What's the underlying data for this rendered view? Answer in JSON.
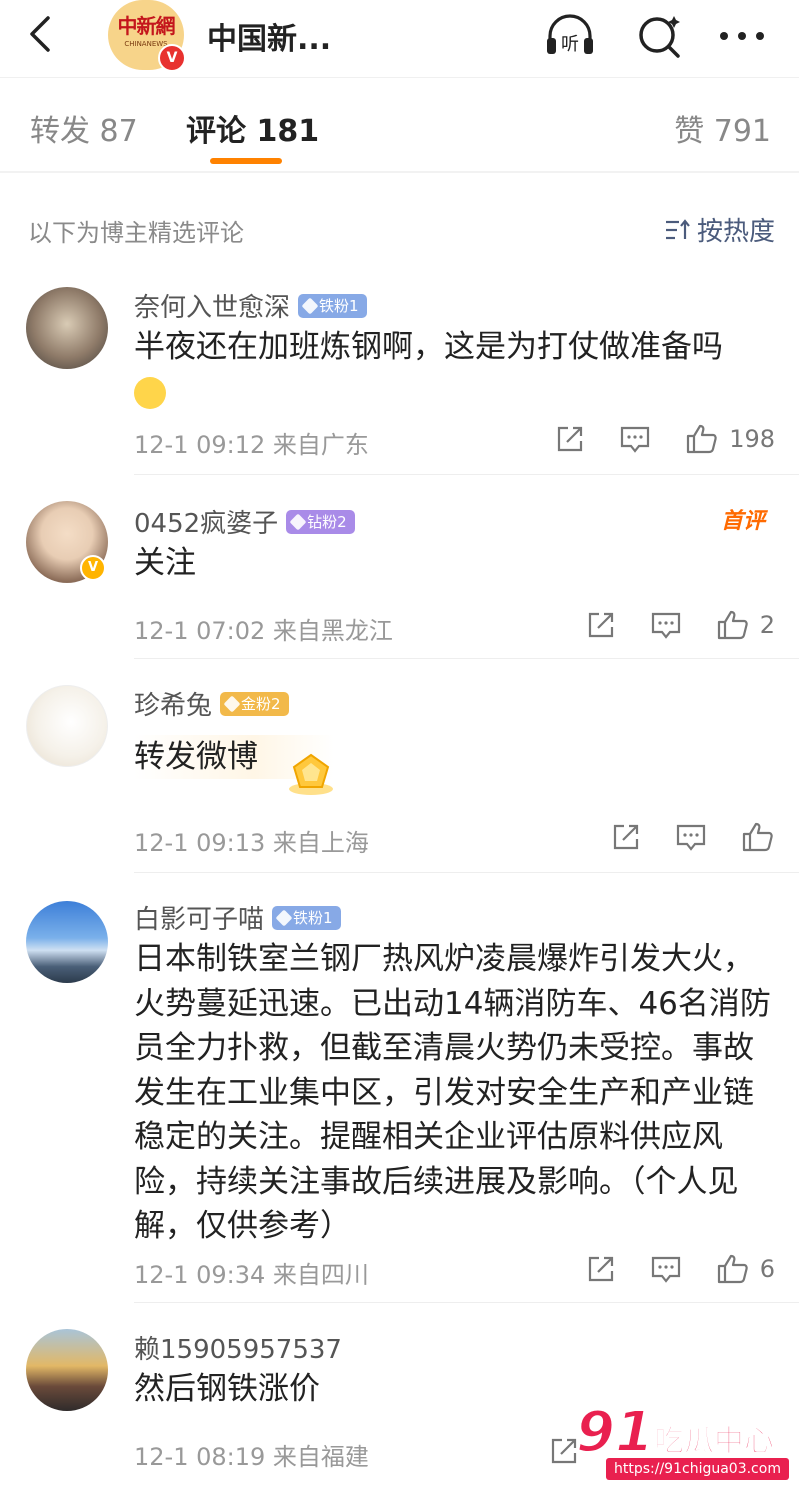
{
  "header": {
    "title": "中国新...",
    "logo_text": "中新網",
    "logo_sub": "CHINANEWS",
    "verified_mark": "V"
  },
  "tabs": [
    {
      "label": "转发 87"
    },
    {
      "label": "评论 181"
    },
    {
      "label": "赞 791"
    }
  ],
  "sort": {
    "label": "以下为博主精选评论",
    "button": "按热度"
  },
  "comments": [
    {
      "user": "奈何入世愈深",
      "badge": "铁粉1",
      "text": "半夜还在加班炼钢啊，这是为打仗做准备吗",
      "time_location": "12-1 09:12 来自广东",
      "likes": "198"
    },
    {
      "user": "0452疯婆子",
      "badge": "钻粉2",
      "tag": "首评",
      "text": "关注",
      "time_location": "12-1 07:02 来自黑龙江",
      "likes": "2"
    },
    {
      "user": "珍希兔",
      "badge": "金粉2",
      "text": "转发微博",
      "time_location": "12-1 09:13 来自上海",
      "likes": ""
    },
    {
      "user": "白影可子喵",
      "badge": "铁粉1",
      "text": "日本制铁室兰钢厂热风炉凌晨爆炸引发大火，火势蔓延迅速。已出动14辆消防车、46名消防员全力扑救，但截至清晨火势仍未受控。事故发生在工业集中区，引发对安全生产和产业链稳定的关注。提醒相关企业评估原料供应风险，持续关注事故后续进展及影响。（个人见解，仅供参考）",
      "time_location": "12-1 09:34 来自四川",
      "likes": "6"
    },
    {
      "user": "赖15905957537",
      "badge": "",
      "text": "然后钢铁涨价",
      "time_location": "12-1 08:19 来自福建",
      "likes": ""
    }
  ],
  "watermark": {
    "number": "91",
    "name": "吃瓜中心",
    "url": "https://91chigua03.com"
  },
  "colors": {
    "accent": "#ff8200",
    "sort_blue": "#4b5b7c",
    "watermark": "#e9204f"
  }
}
